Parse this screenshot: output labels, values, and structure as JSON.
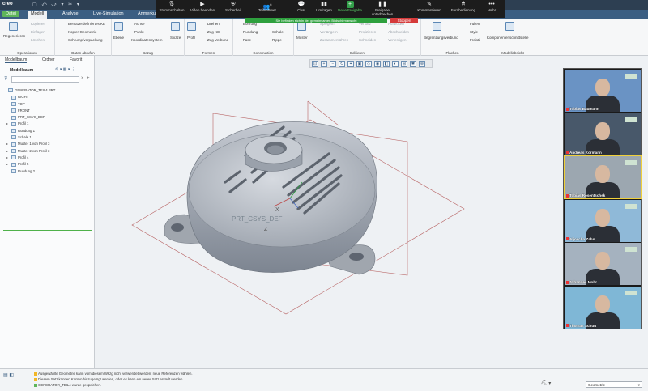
{
  "app": {
    "logo": "creo",
    "quick_access": "▢ ⤺ ⤻ ▾ ✂ ▾"
  },
  "menu": {
    "file": "Datei",
    "model": "Modell",
    "analysis": "Analyse",
    "live_sim": "Live-Simulation",
    "annotate": "Anmerkung"
  },
  "zoom": {
    "items": [
      "Stummschalten",
      "Video beenden",
      "Sicherheit",
      "Teilnehmer",
      "Chat",
      "Umfragen",
      "Neue Freigabe",
      "Freigabe unterbrechen",
      "Kommentieren",
      "Fernbedienung",
      "Mehr"
    ],
    "participants_count": "6",
    "banner": "Sie befinden sich in der gemeinsamen Bildschirmansicht",
    "stop": "Stoppen"
  },
  "ribbon": {
    "operations": {
      "title": "Operationen",
      "regenerate": "Regenerieren",
      "copy": "Kopieren",
      "paste": "Einfügen",
      "delete": "Löschen"
    },
    "data": {
      "title": "Daten abrufen",
      "user_feature": "Benutzerdefiniertes KE",
      "copy_geom": "Kopier-Geometrie",
      "shrinkwrap": "Schrumpfverpackung"
    },
    "datum": {
      "title": "Bezug",
      "plane": "Ebene",
      "axis": "Achse",
      "point": "Punkt",
      "csys": "Koordinatensystem",
      "sketch": "Skizze"
    },
    "shapes": {
      "title": "Formen",
      "profile": "Profil",
      "revolve": "Drehen",
      "sweep": "Zug-KE",
      "helical": "Zug-Verbund"
    },
    "engineering": {
      "title": "Konstruktion",
      "hole": "Bohrung",
      "round": "Rundung",
      "chamfer": "Fase",
      "shell": "Schale",
      "rib": "Rippe"
    },
    "editing": {
      "title": "Editieren",
      "pattern": "Muster",
      "mirror": "Spiegeln",
      "extend": "Verlängern",
      "merge": "Zusammenführen",
      "trim": "Abschneiden",
      "project": "Projizieren",
      "offset": "Versatz",
      "thicken": "Aufdicken",
      "solidify": "Verfestigen",
      "intersect": "Schneiden",
      "extension": "Verbundsatz"
    },
    "surfaces": {
      "title": "Flächen",
      "boundary": "Begrenzungsverbund",
      "fill": "Füllen",
      "style": "Style",
      "freeform": "Freistil"
    },
    "model_intent": {
      "title": "Modellabsicht",
      "component": "Komponentenschnittstelle"
    }
  },
  "panel": {
    "tabs": [
      "Modellbaum",
      "Ordner",
      "Favorit"
    ],
    "title": "Modellbaum",
    "tree": [
      {
        "label": "GENERATOR_TEIL4.PRT",
        "level": 0,
        "expand": ""
      },
      {
        "label": "RIGHT",
        "level": 1,
        "expand": ""
      },
      {
        "label": "TOP",
        "level": 1,
        "expand": ""
      },
      {
        "label": "FRONT",
        "level": 1,
        "expand": ""
      },
      {
        "label": "PRT_CSYS_DEF",
        "level": 1,
        "expand": ""
      },
      {
        "label": "Profil 1",
        "level": 1,
        "expand": "▸"
      },
      {
        "label": "Rundung 1",
        "level": 1,
        "expand": ""
      },
      {
        "label": "Schale 1",
        "level": 1,
        "expand": ""
      },
      {
        "label": "Muster 1 von Profil 3",
        "level": 1,
        "expand": "▸"
      },
      {
        "label": "Muster 2 von Profil 3",
        "level": 1,
        "expand": "▸"
      },
      {
        "label": "Profil 4",
        "level": 1,
        "expand": "▸"
      },
      {
        "label": "Profil 5",
        "level": 1,
        "expand": "▸"
      },
      {
        "label": "Rundung 2",
        "level": 1,
        "expand": ""
      }
    ]
  },
  "viewport": {
    "csys_label": "PRT_CSYS_DEF",
    "axis_x": "X",
    "axis_z": "Z"
  },
  "participants": [
    {
      "name": "Tobias Baumann",
      "bg": "#6a93c4"
    },
    {
      "name": "Andreas Kormann",
      "bg": "#48586a"
    },
    {
      "name": "Tobias Rosentschek",
      "bg": "#9ca7b0"
    },
    {
      "name": "Aljoscha Zahn",
      "bg": "#8fb9d8"
    },
    {
      "name": "Johannes Mohr",
      "bg": "#a5b2bf"
    },
    {
      "name": "Thomas Schütt",
      "bg": "#7fb7d6"
    }
  ],
  "status": {
    "messages": [
      "Ausgewählte Geometrie kann vom diesem Wkzg nicht verwendet werden; neue Referenzen wählen.",
      "Diesem Satz können Kanten hinzugefügt werden, oder es kann ein neuer Satz erstellt werden.",
      "GENERATOR_TEIL4 wurde gespeichert."
    ],
    "filter_value": "Geometrie"
  },
  "colors": {
    "accent": "#3b5e82",
    "zoom_green": "#2ea03e",
    "stop_red": "#d53a3a"
  }
}
